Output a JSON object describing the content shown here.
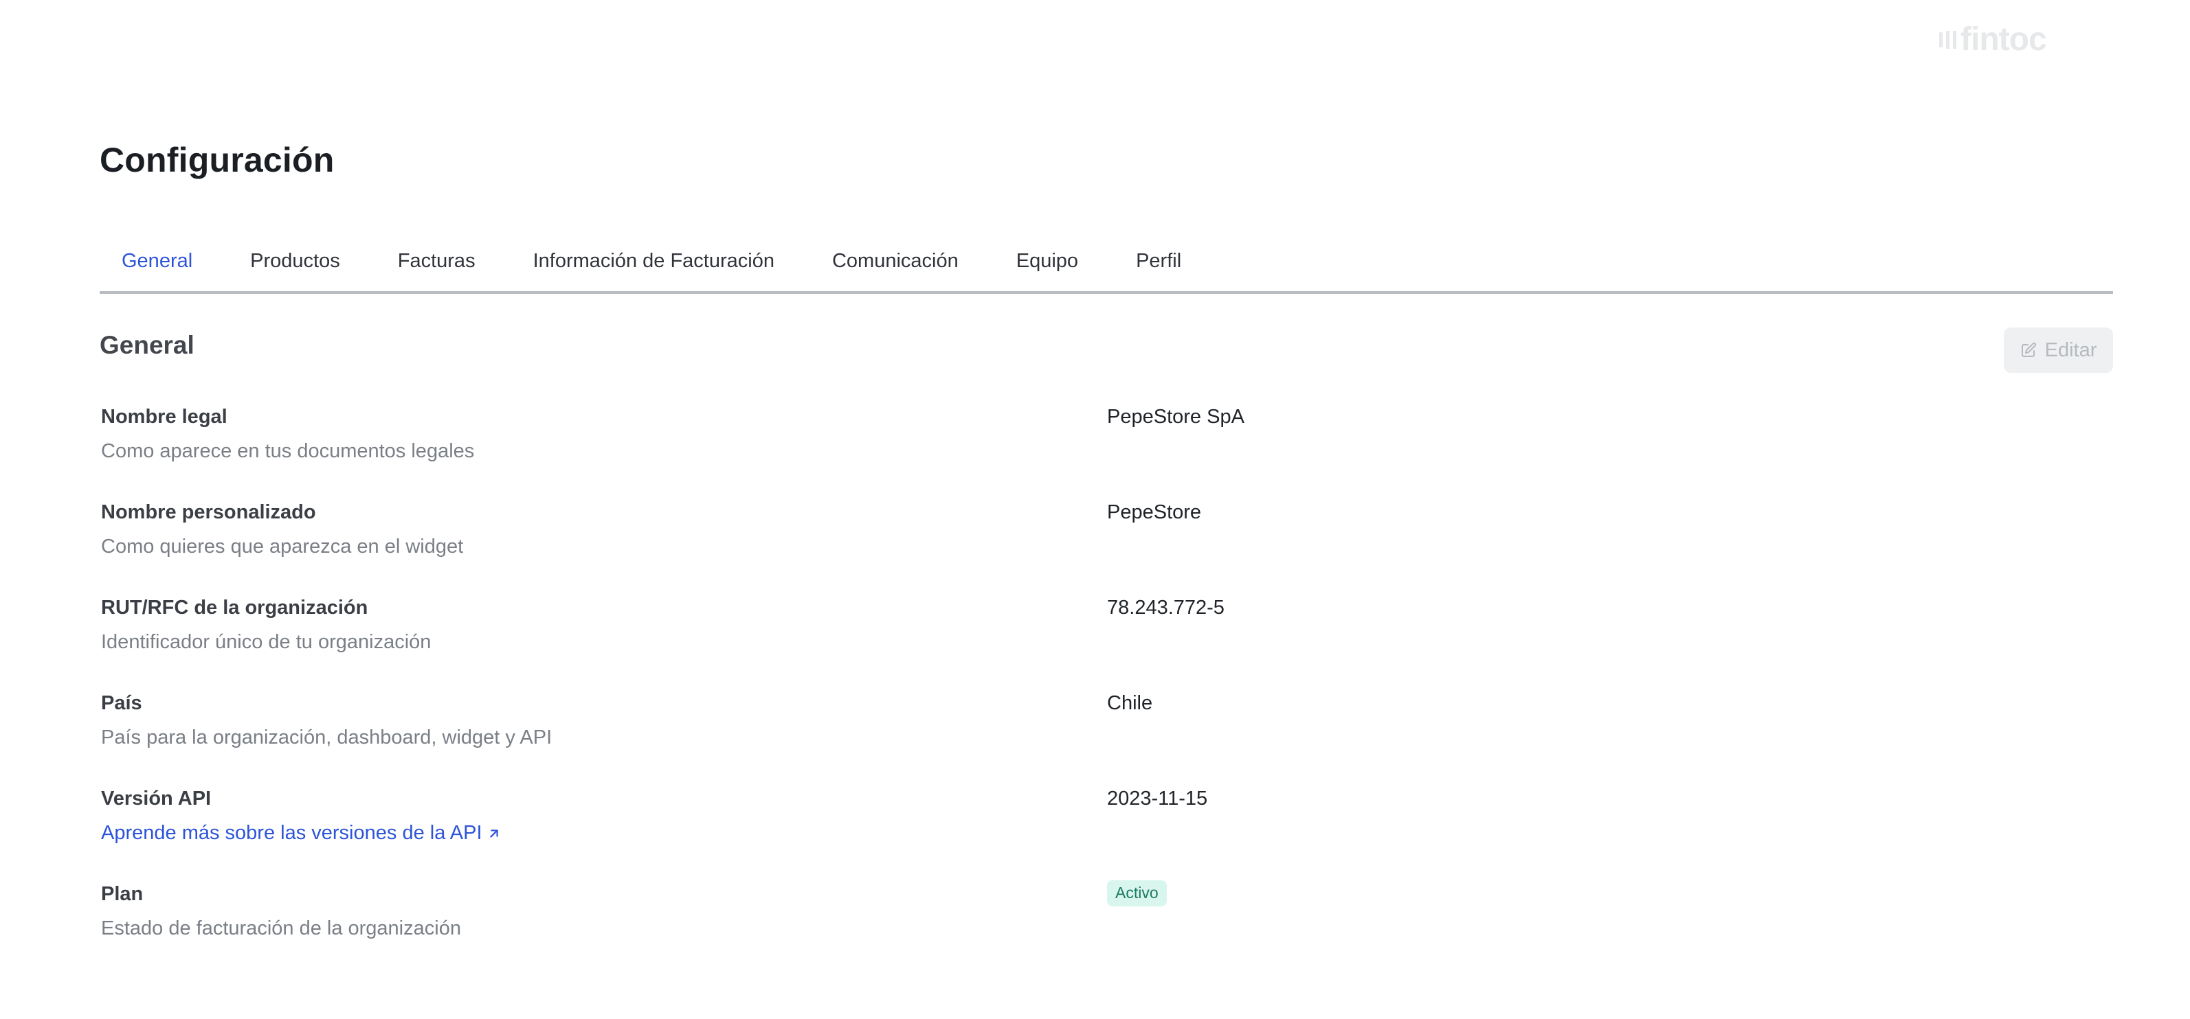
{
  "brand": {
    "logo_text": "fintoc",
    "logo_color": "#e6e8ea"
  },
  "page": {
    "title": "Configuración"
  },
  "tabs": [
    {
      "label": "General",
      "active": true
    },
    {
      "label": "Productos",
      "active": false
    },
    {
      "label": "Facturas",
      "active": false
    },
    {
      "label": "Información de Facturación",
      "active": false
    },
    {
      "label": "Comunicación",
      "active": false
    },
    {
      "label": "Equipo",
      "active": false
    },
    {
      "label": "Perfil",
      "active": false
    }
  ],
  "section": {
    "title": "General",
    "edit_label": "Editar",
    "edit_icon": "edit-icon"
  },
  "rows": [
    {
      "label": "Nombre legal",
      "description": "Como aparece en tus documentos legales",
      "value": "PepeStore SpA"
    },
    {
      "label": "Nombre personalizado",
      "description": "Como quieres que aparezca en el widget",
      "value": "PepeStore"
    },
    {
      "label": "RUT/RFC de la organización",
      "description": "Identificador único de tu organización",
      "value": "78.243.772-5"
    },
    {
      "label": "País",
      "description": "País para la organización, dashboard, widget y API",
      "value": "Chile"
    },
    {
      "label": "Versión API",
      "link": "Aprende más sobre las versiones de la API",
      "link_icon": "external-arrow-icon",
      "value": "2023-11-15"
    },
    {
      "label": "Plan",
      "description": "Estado de facturación de la organización",
      "badge": "Activo"
    }
  ],
  "colors": {
    "accent": "#2d54d8",
    "badge_bg": "#d9f6ee",
    "badge_text": "#1b7a5e"
  }
}
